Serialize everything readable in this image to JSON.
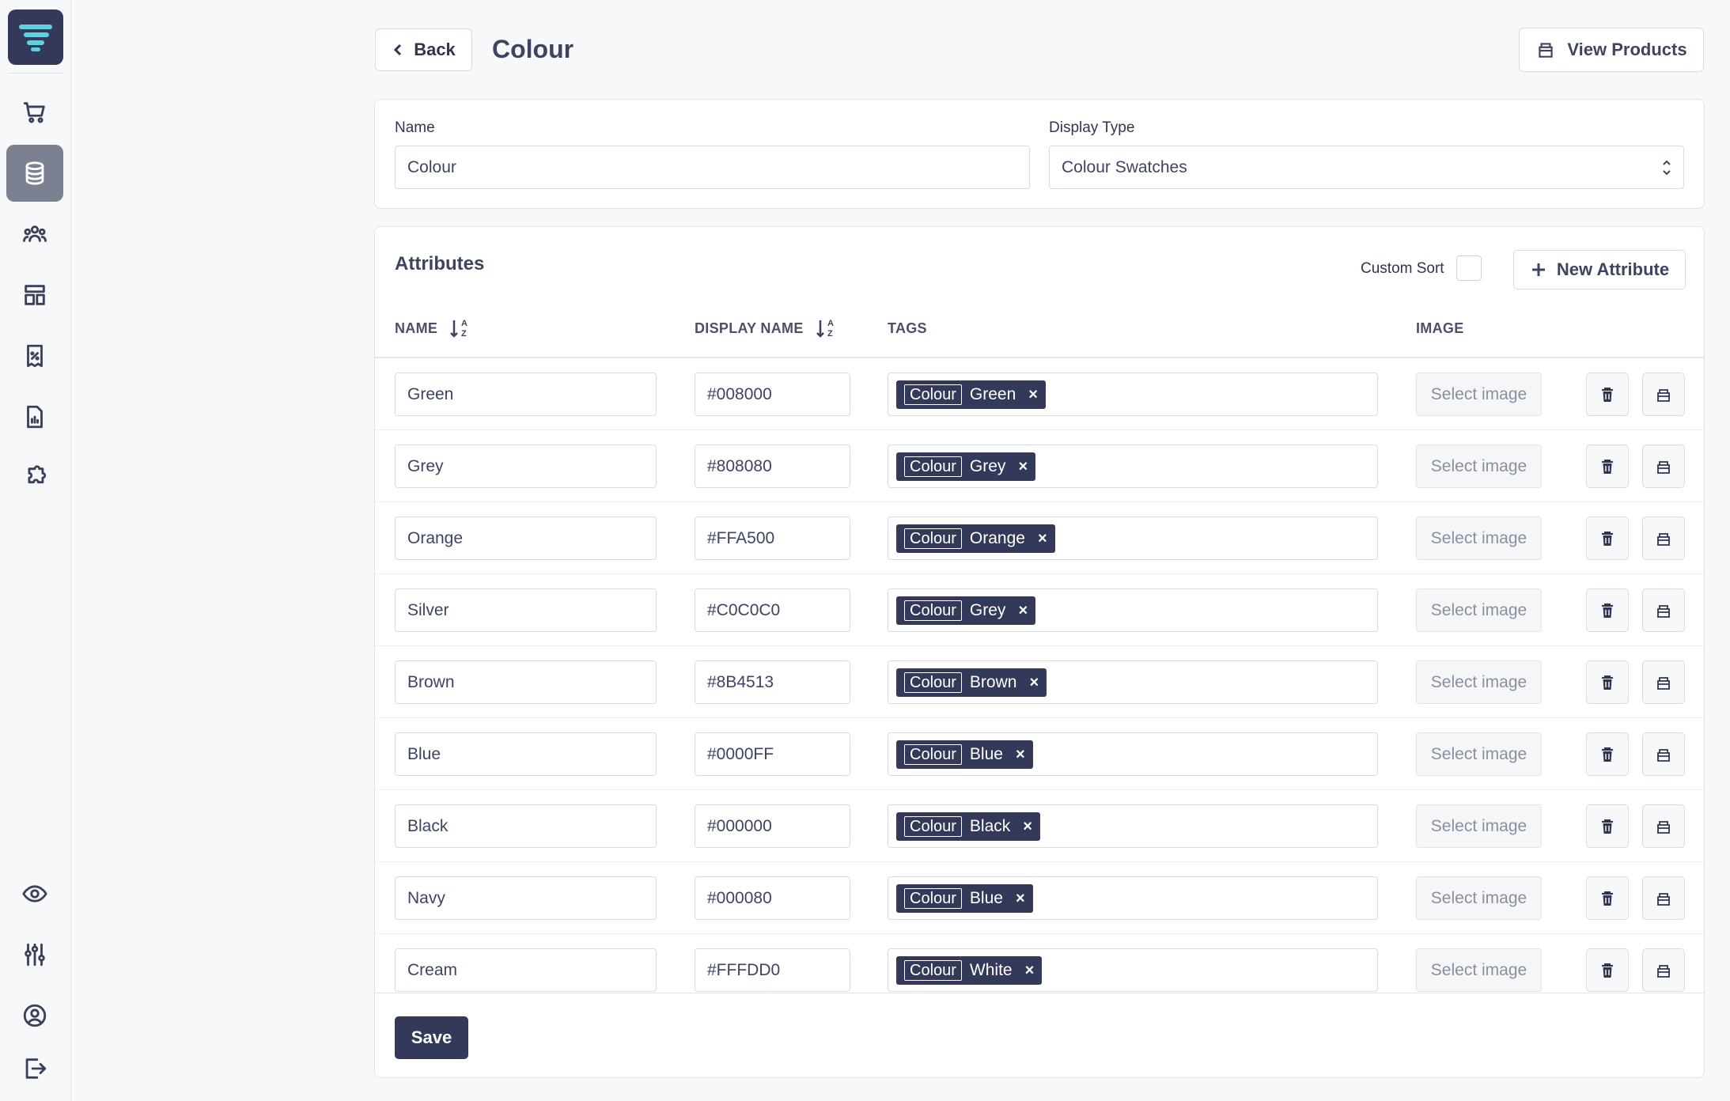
{
  "header": {
    "back_label": "Back",
    "title": "Colour",
    "view_products_label": "View Products"
  },
  "form": {
    "name_label": "Name",
    "name_value": "Colour",
    "display_type_label": "Display Type",
    "display_type_value": "Colour Swatches"
  },
  "attributes": {
    "title": "Attributes",
    "custom_sort_label": "Custom Sort",
    "new_attribute_label": "New Attribute",
    "columns": {
      "name": "NAME",
      "display_name": "DISPLAY NAME",
      "tags": "TAGS",
      "image": "IMAGE"
    },
    "select_image_label": "Select image",
    "rows": [
      {
        "name": "Green",
        "display": "#008000",
        "tag_cat": "Colour",
        "tag_val": "Green"
      },
      {
        "name": "Grey",
        "display": "#808080",
        "tag_cat": "Colour",
        "tag_val": "Grey"
      },
      {
        "name": "Orange",
        "display": "#FFA500",
        "tag_cat": "Colour",
        "tag_val": "Orange"
      },
      {
        "name": "Silver",
        "display": "#C0C0C0",
        "tag_cat": "Colour",
        "tag_val": "Grey"
      },
      {
        "name": "Brown",
        "display": "#8B4513",
        "tag_cat": "Colour",
        "tag_val": "Brown"
      },
      {
        "name": "Blue",
        "display": "#0000FF",
        "tag_cat": "Colour",
        "tag_val": "Blue"
      },
      {
        "name": "Black",
        "display": "#000000",
        "tag_cat": "Colour",
        "tag_val": "Black"
      },
      {
        "name": "Navy",
        "display": "#000080",
        "tag_cat": "Colour",
        "tag_val": "Blue"
      },
      {
        "name": "Cream",
        "display": "#FFFDD0",
        "tag_cat": "Colour",
        "tag_val": "White"
      }
    ]
  },
  "footer": {
    "save_label": "Save"
  },
  "sidebar": {
    "active": "database-icon",
    "icons": [
      "cart-icon",
      "database-icon",
      "users-icon",
      "layout-icon",
      "discount-icon",
      "report-icon",
      "puzzle-icon",
      "eye-icon",
      "sliders-icon",
      "account-icon",
      "logout-icon"
    ]
  },
  "colors": {
    "primary": "#34395a",
    "background": "#f7f8fa",
    "border": "#d8dbe2"
  }
}
